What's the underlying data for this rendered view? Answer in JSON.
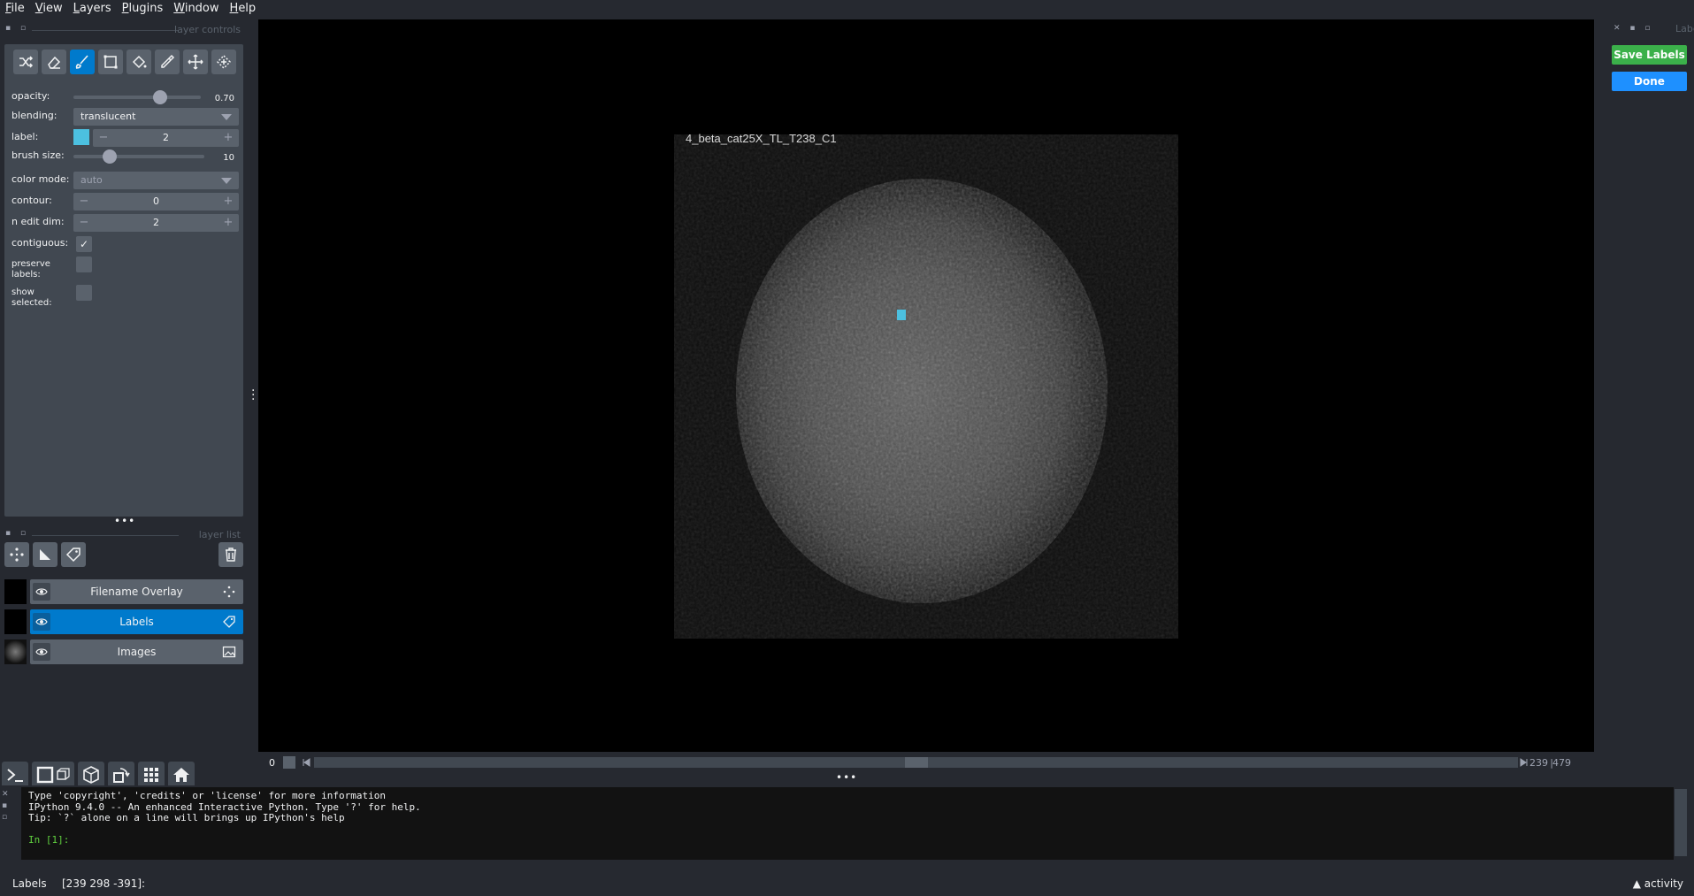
{
  "menu": [
    "File",
    "View",
    "Layers",
    "Plugins",
    "Window",
    "Help"
  ],
  "left_dock": {
    "controls_title": "layer controls",
    "layerlist_title": "layer list"
  },
  "controls": {
    "opacity_label": "opacity:",
    "opacity_value": "0.70",
    "opacity_fraction": 0.7,
    "blending_label": "blending:",
    "blending_value": "translucent",
    "label_label": "label:",
    "label_value": "2",
    "label_color": "#4cc0e0",
    "brush_label": "brush size:",
    "brush_value": "10",
    "brush_fraction": 0.25,
    "colormode_label": "color mode:",
    "colormode_value": "auto",
    "contour_label": "contour:",
    "contour_value": "0",
    "nedit_label": "n edit dim:",
    "nedit_value": "2",
    "contiguous_label": "contiguous:",
    "preserve_label": "preserve\nlabels:",
    "show_selected_label": "show\nselected:",
    "checkmark": "✓",
    "minus": "−",
    "plus": "+"
  },
  "tools": [
    "shuffle-icon",
    "eraser-icon",
    "paintbrush-icon",
    "polygon-icon",
    "fill-bucket-icon",
    "color-picker-icon",
    "pan-zoom-icon",
    "transform-icon"
  ],
  "layers": [
    {
      "name": "Filename Overlay",
      "type": "points"
    },
    {
      "name": "Labels",
      "type": "labels",
      "selected": true
    },
    {
      "name": "Images",
      "type": "image"
    }
  ],
  "canvas": {
    "image_label": "4_beta_cat25X_TL_T238_C1"
  },
  "dims": {
    "index": "0",
    "current": "239",
    "total": "479",
    "slider_fraction": 0.5
  },
  "console": {
    "line1": "Type 'copyright', 'credits' or 'license' for more information",
    "line2": "IPython 9.4.0 -- An enhanced Interactive Python. Type '?' for help.",
    "line3": "Tip: `?` alone on a line will brings up IPython's help",
    "prompt": "In [1]:"
  },
  "status": {
    "layer": "Labels",
    "coords": "[239 298 -391]:",
    "activity": "activity"
  },
  "right_dock": {
    "title": "Labeli",
    "save_label": "Save Labels",
    "done_label": "Done"
  },
  "colors": {
    "bg": "#262930",
    "panel": "#414851",
    "control": "#5a626c",
    "accent": "#007acc",
    "save": "#3bb04a",
    "done": "#1e90ff"
  }
}
